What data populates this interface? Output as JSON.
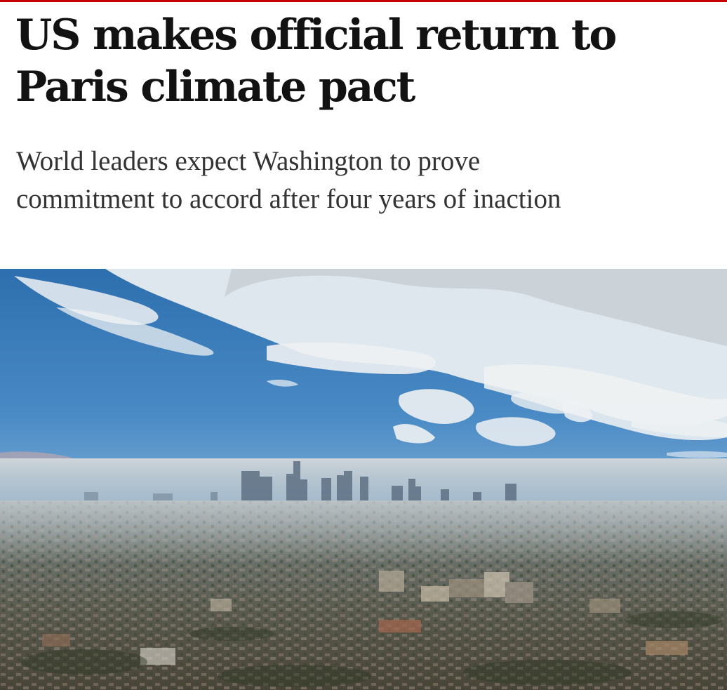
{
  "article": {
    "headline": "US makes official return to Paris climate pact",
    "standfirst": "World leaders expect Washington to prove commitment to accord after four years of inaction"
  },
  "hero_image": {
    "subject": "hazy-city-skyline-photo"
  },
  "colors": {
    "accent_rule": "#c70000",
    "headline_text": "#121212",
    "standfirst_text": "#333333"
  }
}
